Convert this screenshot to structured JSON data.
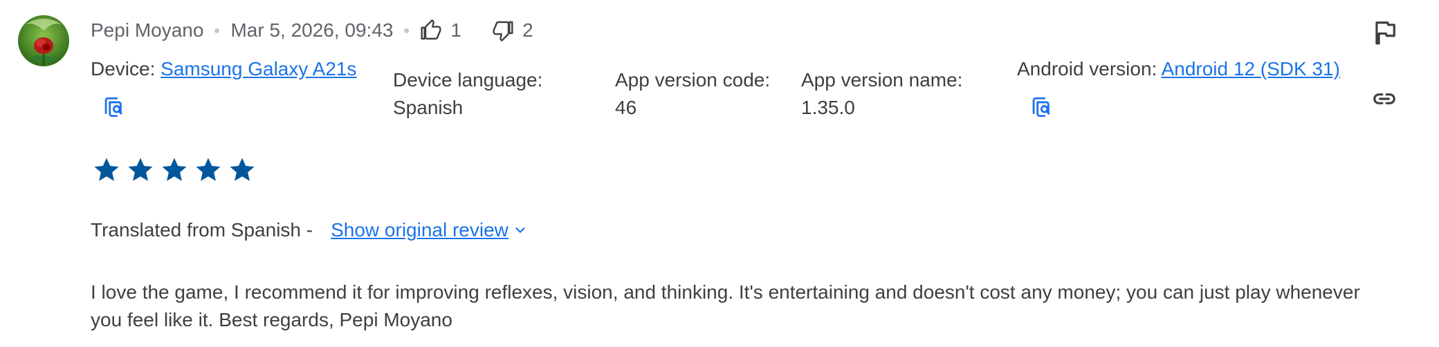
{
  "review": {
    "author": "Pepi Moyano",
    "date": "Mar 5, 2026, 09:43",
    "helpful_count": "1",
    "unhelpful_count": "2",
    "rating": 5,
    "translated_label": "Translated from Spanish -",
    "show_original_label": "Show original review",
    "text": "I love the game, I recommend it for improving reflexes, vision, and thinking. It's entertaining and doesn't cost any money; you can just play whenever you feel like it. Best regards, Pepi Moyano"
  },
  "device": {
    "label": "Device:",
    "value": "Samsung Galaxy A21s"
  },
  "device_language": {
    "label": "Device language:",
    "value": "Spanish"
  },
  "app_version_code": {
    "label": "App version code:",
    "value": "46"
  },
  "app_version_name": {
    "label": "App version name:",
    "value": "1.35.0"
  },
  "android_version": {
    "label": "Android version:",
    "value": "Android 12 (SDK 31)"
  },
  "icons": {
    "thumbs_up": "thumbs-up-icon",
    "thumbs_down": "thumbs-down-icon",
    "flag": "flag-icon",
    "link": "link-icon",
    "copy_device": "copy-details-icon",
    "copy_android": "copy-details-icon",
    "star": "star-icon",
    "chevron": "chevron-down-icon"
  },
  "colors": {
    "accent": "#1a73e8",
    "star": "#01579b",
    "text": "#3c4043",
    "secondary_text": "#5f6368"
  }
}
